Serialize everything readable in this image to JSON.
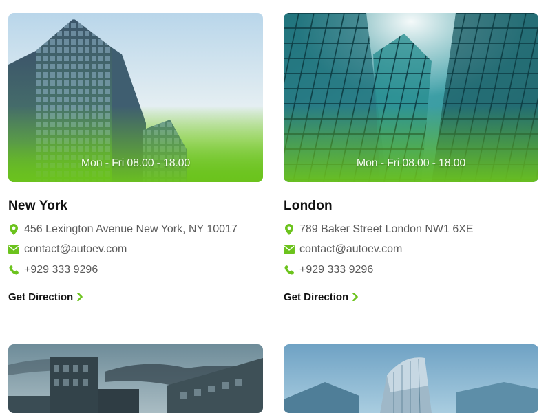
{
  "accent_color": "#6cc31d",
  "locations": [
    {
      "hours": "Mon - Fri 08.00 - 18.00",
      "city": "New York",
      "address": "456 Lexington Avenue New York, NY 10017",
      "email": "contact@autoev.com",
      "phone": "+929 333 9296",
      "link_label": "Get Direction"
    },
    {
      "hours": "Mon - Fri 08.00 - 18.00",
      "city": "London",
      "address": "789 Baker Street London NW1 6XE",
      "email": "contact@autoev.com",
      "phone": "+929 333 9296",
      "link_label": "Get Direction"
    }
  ],
  "icons": {
    "address": "map-pin-icon",
    "email": "envelope-icon",
    "phone": "phone-icon",
    "link": "chevron-right-icon"
  }
}
